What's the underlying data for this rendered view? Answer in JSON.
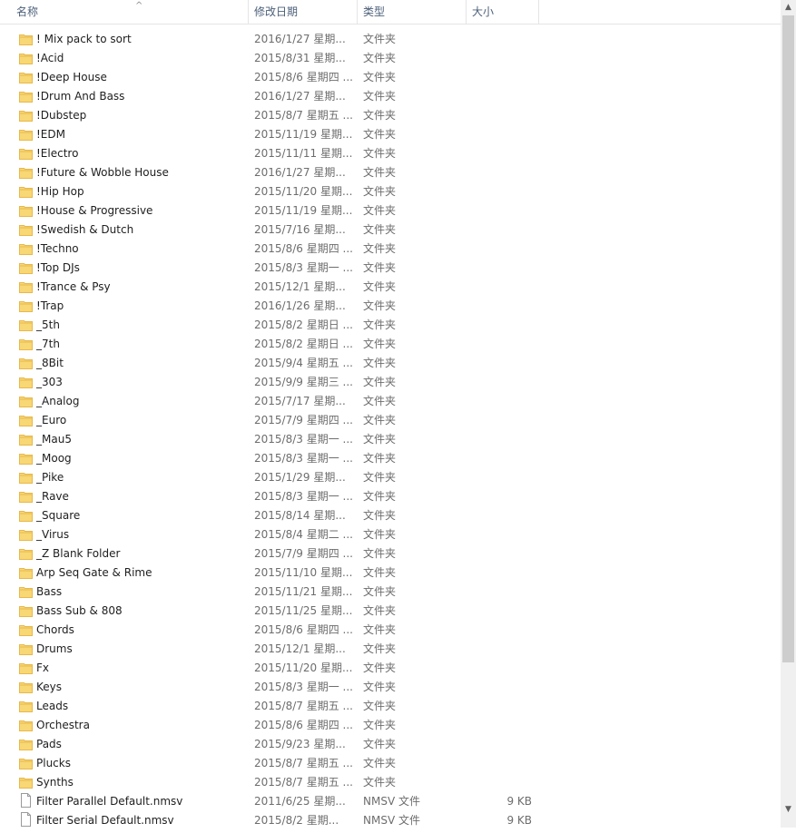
{
  "columns": {
    "name": "名称",
    "date": "修改日期",
    "type": "类型",
    "size": "大小"
  },
  "sort_indicator": "^",
  "items": [
    {
      "kind": "folder",
      "name": "! Mix pack to sort",
      "date": "2016/1/27 星期...",
      "type": "文件夹",
      "size": ""
    },
    {
      "kind": "folder",
      "name": "!Acid",
      "date": "2015/8/31 星期...",
      "type": "文件夹",
      "size": ""
    },
    {
      "kind": "folder",
      "name": "!Deep House",
      "date": "2015/8/6 星期四 ...",
      "type": "文件夹",
      "size": ""
    },
    {
      "kind": "folder",
      "name": "!Drum And Bass",
      "date": "2016/1/27 星期...",
      "type": "文件夹",
      "size": ""
    },
    {
      "kind": "folder",
      "name": "!Dubstep",
      "date": "2015/8/7 星期五 ...",
      "type": "文件夹",
      "size": ""
    },
    {
      "kind": "folder",
      "name": "!EDM",
      "date": "2015/11/19 星期...",
      "type": "文件夹",
      "size": ""
    },
    {
      "kind": "folder",
      "name": "!Electro",
      "date": "2015/11/11 星期...",
      "type": "文件夹",
      "size": ""
    },
    {
      "kind": "folder",
      "name": "!Future & Wobble House",
      "date": "2016/1/27 星期...",
      "type": "文件夹",
      "size": ""
    },
    {
      "kind": "folder",
      "name": "!Hip Hop",
      "date": "2015/11/20 星期...",
      "type": "文件夹",
      "size": ""
    },
    {
      "kind": "folder",
      "name": "!House & Progressive",
      "date": "2015/11/19 星期...",
      "type": "文件夹",
      "size": ""
    },
    {
      "kind": "folder",
      "name": "!Swedish & Dutch",
      "date": "2015/7/16 星期...",
      "type": "文件夹",
      "size": ""
    },
    {
      "kind": "folder",
      "name": "!Techno",
      "date": "2015/8/6 星期四 ...",
      "type": "文件夹",
      "size": ""
    },
    {
      "kind": "folder",
      "name": "!Top DJs",
      "date": "2015/8/3 星期一 ...",
      "type": "文件夹",
      "size": ""
    },
    {
      "kind": "folder",
      "name": "!Trance & Psy",
      "date": "2015/12/1 星期...",
      "type": "文件夹",
      "size": ""
    },
    {
      "kind": "folder",
      "name": "!Trap",
      "date": "2016/1/26 星期...",
      "type": "文件夹",
      "size": ""
    },
    {
      "kind": "folder",
      "name": "_5th",
      "date": "2015/8/2 星期日 ...",
      "type": "文件夹",
      "size": ""
    },
    {
      "kind": "folder",
      "name": "_7th",
      "date": "2015/8/2 星期日 ...",
      "type": "文件夹",
      "size": ""
    },
    {
      "kind": "folder",
      "name": "_8Bit",
      "date": "2015/9/4 星期五 ...",
      "type": "文件夹",
      "size": ""
    },
    {
      "kind": "folder",
      "name": "_303",
      "date": "2015/9/9 星期三 ...",
      "type": "文件夹",
      "size": ""
    },
    {
      "kind": "folder",
      "name": "_Analog",
      "date": "2015/7/17 星期...",
      "type": "文件夹",
      "size": ""
    },
    {
      "kind": "folder",
      "name": "_Euro",
      "date": "2015/7/9 星期四 ...",
      "type": "文件夹",
      "size": ""
    },
    {
      "kind": "folder",
      "name": "_Mau5",
      "date": "2015/8/3 星期一 ...",
      "type": "文件夹",
      "size": ""
    },
    {
      "kind": "folder",
      "name": "_Moog",
      "date": "2015/8/3 星期一 ...",
      "type": "文件夹",
      "size": ""
    },
    {
      "kind": "folder",
      "name": "_Pike",
      "date": "2015/1/29 星期...",
      "type": "文件夹",
      "size": ""
    },
    {
      "kind": "folder",
      "name": "_Rave",
      "date": "2015/8/3 星期一 ...",
      "type": "文件夹",
      "size": ""
    },
    {
      "kind": "folder",
      "name": "_Square",
      "date": "2015/8/14 星期...",
      "type": "文件夹",
      "size": ""
    },
    {
      "kind": "folder",
      "name": "_Virus",
      "date": "2015/8/4 星期二 ...",
      "type": "文件夹",
      "size": ""
    },
    {
      "kind": "folder",
      "name": "_Z Blank Folder",
      "date": "2015/7/9 星期四 ...",
      "type": "文件夹",
      "size": ""
    },
    {
      "kind": "folder",
      "name": "Arp Seq Gate & Rime",
      "date": "2015/11/10 星期...",
      "type": "文件夹",
      "size": ""
    },
    {
      "kind": "folder",
      "name": "Bass",
      "date": "2015/11/21 星期...",
      "type": "文件夹",
      "size": ""
    },
    {
      "kind": "folder",
      "name": "Bass Sub & 808",
      "date": "2015/11/25 星期...",
      "type": "文件夹",
      "size": ""
    },
    {
      "kind": "folder",
      "name": "Chords",
      "date": "2015/8/6 星期四 ...",
      "type": "文件夹",
      "size": ""
    },
    {
      "kind": "folder",
      "name": "Drums",
      "date": "2015/12/1 星期...",
      "type": "文件夹",
      "size": ""
    },
    {
      "kind": "folder",
      "name": "Fx",
      "date": "2015/11/20 星期...",
      "type": "文件夹",
      "size": ""
    },
    {
      "kind": "folder",
      "name": "Keys",
      "date": "2015/8/3 星期一 ...",
      "type": "文件夹",
      "size": ""
    },
    {
      "kind": "folder",
      "name": "Leads",
      "date": "2015/8/7 星期五 ...",
      "type": "文件夹",
      "size": ""
    },
    {
      "kind": "folder",
      "name": "Orchestra",
      "date": "2015/8/6 星期四 ...",
      "type": "文件夹",
      "size": ""
    },
    {
      "kind": "folder",
      "name": "Pads",
      "date": "2015/9/23 星期...",
      "type": "文件夹",
      "size": ""
    },
    {
      "kind": "folder",
      "name": "Plucks",
      "date": "2015/8/7 星期五 ...",
      "type": "文件夹",
      "size": ""
    },
    {
      "kind": "folder",
      "name": "Synths",
      "date": "2015/8/7 星期五 ...",
      "type": "文件夹",
      "size": ""
    },
    {
      "kind": "file",
      "name": "Filter Parallel Default.nmsv",
      "date": "2011/6/25 星期...",
      "type": "NMSV 文件",
      "size": "9 KB"
    },
    {
      "kind": "file",
      "name": "Filter Serial Default.nmsv",
      "date": "2015/8/2 星期...",
      "type": "NMSV 文件",
      "size": "9 KB"
    }
  ],
  "scrollbar": {
    "up_arrow": "▲",
    "down_arrow": "▼"
  },
  "colors": {
    "folder_fill": "#f8d775",
    "folder_tab": "#e8b84a",
    "header_text": "#4c607a",
    "secondary_text": "#6d6d6d"
  }
}
